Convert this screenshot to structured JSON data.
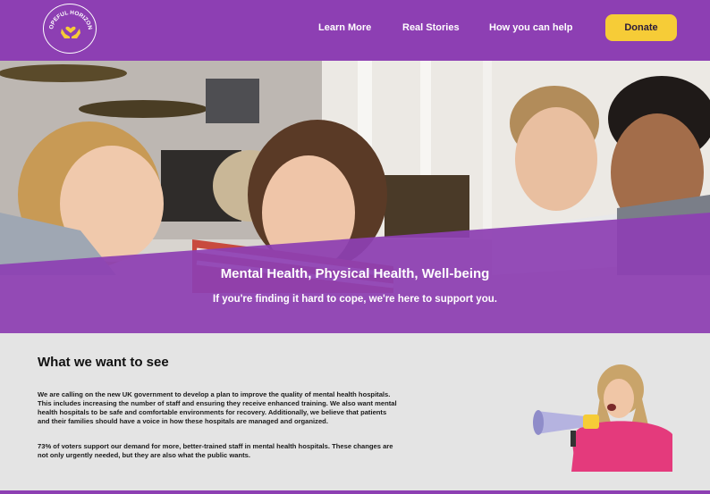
{
  "nav": {
    "logo_text": "HOPEFUL HORIZONS",
    "links": [
      {
        "label": "Learn More"
      },
      {
        "label": "Real Stories"
      },
      {
        "label": "How you can help"
      }
    ],
    "donate_label": "Donate"
  },
  "hero": {
    "title": "Mental Health, Physical Health, Well-being",
    "subtitle": "If you're finding it hard to cope, we're here to support you."
  },
  "main": {
    "heading": "What we want to see",
    "paragraphs": [
      "We are calling on the new UK government to develop a plan to improve the quality of mental health hospitals. This includes increasing the number of staff and ensuring they receive enhanced training. We also want mental health hospitals to be safe and comfortable environments for recovery. Additionally, we believe that patients and their families should have a voice in how these hospitals are managed and organized.",
      "73% of voters support our demand for more, better-trained staff in mental health hospitals. These changes are not only urgently needed, but they are also what the public wants."
    ]
  },
  "colors": {
    "brand_purple": "#8d3fb3",
    "donate_yellow": "#f6cc37",
    "background": "#e4e4e4"
  }
}
